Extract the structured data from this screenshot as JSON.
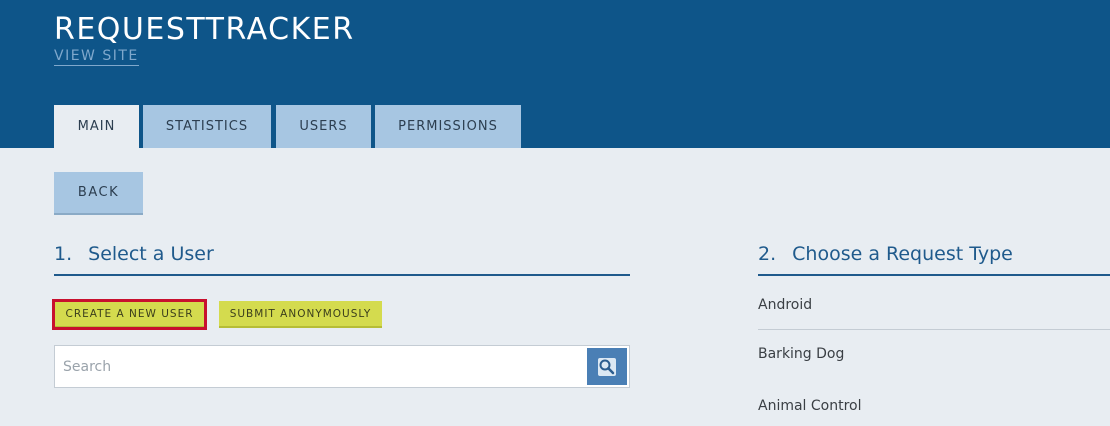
{
  "header": {
    "app_title": "REQUESTTRACKER",
    "view_site": "VIEW SITE"
  },
  "tabs": [
    {
      "label": "MAIN",
      "active": true
    },
    {
      "label": "STATISTICS",
      "active": false
    },
    {
      "label": "USERS",
      "active": false
    },
    {
      "label": "PERMISSIONS",
      "active": false
    }
  ],
  "back_label": "BACK",
  "select_user": {
    "number": "1.",
    "title": "Select a User",
    "create_new_user": "CREATE A NEW USER",
    "submit_anonymously": "SUBMIT ANONYMOUSLY",
    "search_placeholder": "Search"
  },
  "request_type": {
    "number": "2.",
    "title": "Choose a Request Type",
    "items": [
      "Android",
      "Barking Dog",
      "Animal Control"
    ]
  },
  "colors": {
    "header_bg": "#0e5589",
    "tab_bg": "#a7c6e2",
    "accent_yellow": "#d4db4e",
    "selection_outline": "#c8102e",
    "section_title": "#1f5a8c"
  }
}
